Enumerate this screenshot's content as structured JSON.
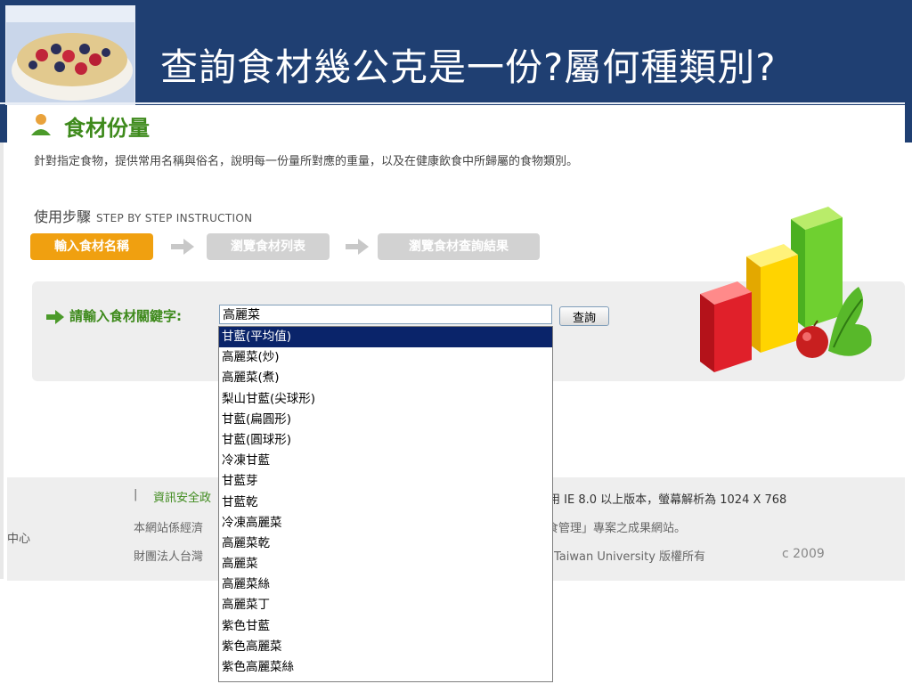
{
  "header": {
    "title": "查詢食材幾公克是一份?屬何種類別?"
  },
  "app": {
    "title": "食材份量",
    "description": "針對指定食物，提供常用名稱與俗名，說明每一份量所對應的重量，以及在健康飲食中所歸屬的食物類別。",
    "steps_label": "使用步驟",
    "steps_label_en": "STEP BY STEP INSTRUCTION",
    "steps": [
      {
        "label": "輸入食材名稱",
        "active": true
      },
      {
        "label": "瀏覽食材列表",
        "active": false
      },
      {
        "label": "瀏覽食材查詢結果",
        "active": false
      }
    ]
  },
  "search": {
    "label": "請輸入食材關鍵字:",
    "value": "高麗菜",
    "button_label": "查詢"
  },
  "autocomplete": {
    "selected_index": 0,
    "items": [
      "甘藍(平均值)",
      "高麗菜(炒)",
      "高麗菜(煮)",
      "梨山甘藍(尖球形)",
      "甘藍(扁圓形)",
      "甘藍(圓球形)",
      "冷凍甘藍",
      "甘藍芽",
      "甘藍乾",
      "冷凍高麗菜",
      "高麗菜乾",
      "高麗菜",
      "高麗菜絲",
      "高麗菜丁",
      "紫色甘藍",
      "紫色高麗菜",
      "紫色高麗菜絲"
    ]
  },
  "footer": {
    "separator": "|",
    "link_text": "資訊安全政",
    "left_org": "中心",
    "line2_prefix": "本網站係經濟",
    "line3_prefix": "財團法人台灣",
    "browser_note": "用 IE 8.0 以上版本，螢幕解析為 1024 X 768",
    "project_note": "食管理」專案之成果網站。",
    "copyright_note": "Taiwan University 版權所有",
    "year": "c 2009"
  },
  "colors": {
    "header_bg": "#1f3f72",
    "accent_green": "#3e8a1c",
    "step_active": "#f0a010",
    "step_inactive": "#d2d2d2",
    "dropdown_selected": "#0a246a"
  }
}
